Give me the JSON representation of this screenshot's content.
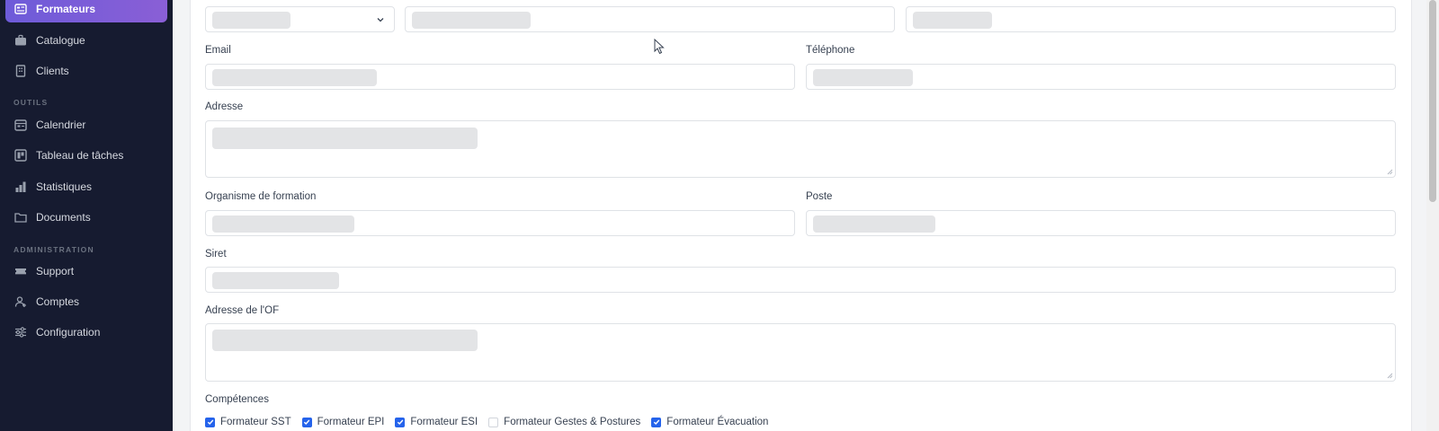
{
  "sidebar": {
    "items": [
      {
        "label": "Formateurs",
        "icon": "book-open-icon",
        "active": true
      },
      {
        "label": "Catalogue",
        "icon": "briefcase-icon"
      },
      {
        "label": "Clients",
        "icon": "building-icon"
      },
      {
        "label": "Calendrier",
        "icon": "calendar-icon"
      },
      {
        "label": "Tableau de tâches",
        "icon": "kanban-icon"
      },
      {
        "label": "Statistiques",
        "icon": "bar-chart-icon"
      },
      {
        "label": "Documents",
        "icon": "folder-icon"
      },
      {
        "label": "Support",
        "icon": "ticket-icon"
      },
      {
        "label": "Comptes",
        "icon": "users-icon"
      },
      {
        "label": "Configuration",
        "icon": "sliders-icon"
      }
    ],
    "sections": {
      "outils": "OUTILS",
      "administration": "ADMINISTRATION"
    }
  },
  "form": {
    "email_label": "Email",
    "telephone_label": "Téléphone",
    "adresse_label": "Adresse",
    "organisme_label": "Organisme de formation",
    "poste_label": "Poste",
    "siret_label": "Siret",
    "adresse_of_label": "Adresse de l'OF",
    "competences_label": "Compétences",
    "competences": [
      {
        "label": "Formateur SST",
        "checked": true
      },
      {
        "label": "Formateur EPI",
        "checked": true
      },
      {
        "label": "Formateur ESI",
        "checked": true
      },
      {
        "label": "Formateur Gestes & Postures",
        "checked": false
      },
      {
        "label": "Formateur Évacuation",
        "checked": true
      }
    ]
  },
  "colors": {
    "sidebar_bg": "#161b30",
    "active_gradient_start": "#6d5bd9",
    "active_gradient_end": "#8a5fd6",
    "check_blue": "#2563eb"
  }
}
